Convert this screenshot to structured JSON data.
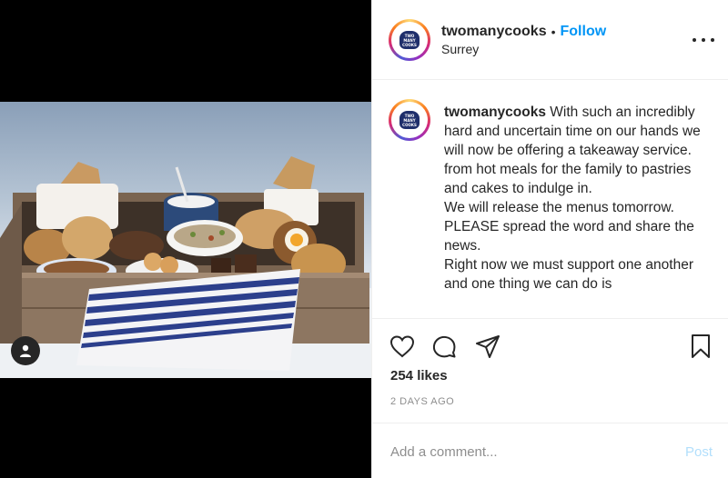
{
  "post": {
    "username": "twomanycooks",
    "dot": "•",
    "follow_label": "Follow",
    "location": "Surrey",
    "logo_text": [
      "TWO",
      "MANY",
      "COOKS"
    ],
    "caption_text": " With such an incredibly hard and uncertain time on our hands we will now be offering a takeaway service.\nfrom hot meals for the family to pastries and cakes to indulge in.\nWe will release the menus tomorrow.\nPLEASE spread the word and share the news.\nRight now we must support one another and one thing we can do is",
    "likes": "254 likes",
    "timestamp": "2 DAYS AGO",
    "comment_placeholder": "Add a comment...",
    "post_label": "Post"
  },
  "icons": {
    "like": "heart-icon",
    "comment": "comment-icon",
    "share": "paper-plane-icon",
    "save": "bookmark-icon",
    "more": "more-options-icon",
    "tagged_user": "user-tag-icon"
  },
  "colors": {
    "follow": "#0095f6",
    "post_disabled": "#b2dffc",
    "text": "#262626",
    "muted": "#8e8e8e",
    "logo": "#1f2f6b"
  }
}
